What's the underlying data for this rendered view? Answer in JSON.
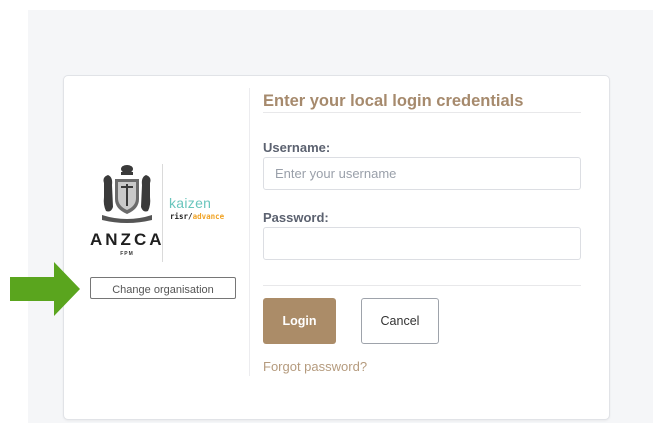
{
  "logo": {
    "org_name": "ANZCA",
    "org_sub": "FPM",
    "kaizen": "kaizen",
    "risr_prefix": "risr/",
    "risr_suffix": "advance"
  },
  "change_org_label": "Change organisation",
  "form": {
    "heading": "Enter your local login credentials",
    "username_label": "Username:",
    "username_placeholder": "Enter your username",
    "username_value": "",
    "password_label": "Password:",
    "password_value": "",
    "login_label": "Login",
    "cancel_label": "Cancel",
    "forgot_label": "Forgot password?"
  },
  "colors": {
    "accent": "#ab8c68",
    "arrow": "#5aa51e",
    "kaizen": "#6ac6bd",
    "advance": "#f0a325"
  },
  "icons": {
    "arrow": "green-right-arrow-icon",
    "crest": "anzca-crest-logo"
  }
}
